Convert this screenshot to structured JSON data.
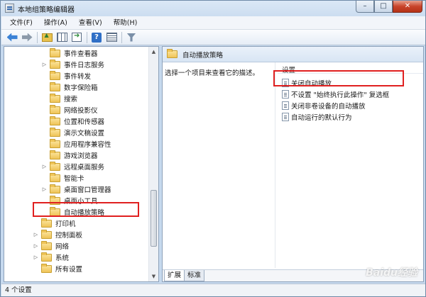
{
  "window": {
    "title": "本地组策略编辑器"
  },
  "window_buttons": {
    "minimize": "–",
    "maximize": "□",
    "close": "✕"
  },
  "menu": [
    "文件(F)",
    "操作(A)",
    "查看(V)",
    "帮助(H)"
  ],
  "toolbar_icons": [
    "back-arrow-icon",
    "forward-arrow-icon",
    "up-folder-icon",
    "show-hide-tree-icon",
    "export-list-icon",
    "help-icon",
    "properties-icon",
    "filter-icon"
  ],
  "tree": [
    {
      "label": "事件查看器",
      "expander": ""
    },
    {
      "label": "事件日志服务",
      "expander": "▷"
    },
    {
      "label": "事件转发",
      "expander": ""
    },
    {
      "label": "数字保险箱",
      "expander": ""
    },
    {
      "label": "搜索",
      "expander": ""
    },
    {
      "label": "网络投影仪",
      "expander": ""
    },
    {
      "label": "位置和传感器",
      "expander": ""
    },
    {
      "label": "演示文稿设置",
      "expander": ""
    },
    {
      "label": "应用程序兼容性",
      "expander": ""
    },
    {
      "label": "游戏浏览器",
      "expander": ""
    },
    {
      "label": "远程桌面服务",
      "expander": "▷"
    },
    {
      "label": "智能卡",
      "expander": ""
    },
    {
      "label": "桌面窗口管理器",
      "expander": "▷"
    },
    {
      "label": "桌面小工具",
      "expander": ""
    },
    {
      "label": "自动播放策略",
      "expander": ""
    }
  ],
  "tree_parent": [
    {
      "label": "打印机",
      "expander": ""
    },
    {
      "label": "控制面板",
      "expander": "▷"
    },
    {
      "label": "网络",
      "expander": "▷"
    },
    {
      "label": "系统",
      "expander": "▷"
    },
    {
      "label": "所有设置",
      "expander": ""
    }
  ],
  "right_pane": {
    "header_title": "自动播放策略",
    "description": "选择一个项目来查看它的描述。",
    "column_header": "设置",
    "settings": [
      "关闭自动播放",
      "不设置 \"始终执行此操作\" 复选框",
      "关闭非卷设备的自动播放",
      "自动运行的默认行为"
    ],
    "tabs": [
      "扩展",
      "标准"
    ]
  },
  "status": {
    "text": "4 个设置"
  },
  "watermark": "Baidu经验",
  "colors": {
    "highlight_box": "#e02020",
    "folder": "#efc458"
  }
}
